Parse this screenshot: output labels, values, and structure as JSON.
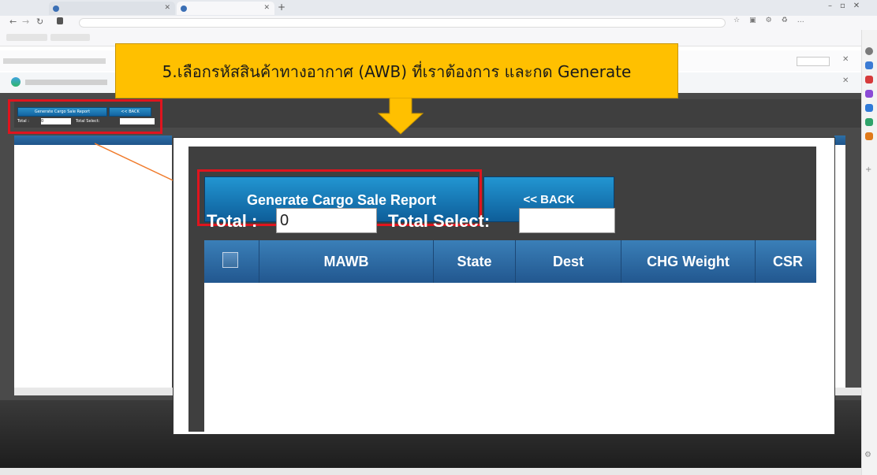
{
  "annotation": {
    "callout_text": "5.เลือกรหัสสินค้าทางอากาศ (AWB) ที่เราต้องการ และกด Generate"
  },
  "app": {
    "generate_button": "Generate Cargo Sale Report",
    "back_button": "<< BACK",
    "total_label": "Total :",
    "total_value": "0",
    "total_select_label": "Total Select:",
    "total_select_value": "",
    "columns": [
      "MAWB",
      "State",
      "Dest",
      "CHG Weight",
      "CSR"
    ]
  },
  "colors": {
    "callout_bg": "#ffc000",
    "highlight_border": "#e0141e",
    "button_blue": "#1a7dbb",
    "table_header": "#2d6aa3",
    "page_dark": "#3f3f3f"
  },
  "icons": [
    "back-arrow-icon",
    "forward-arrow-icon",
    "refresh-icon",
    "home-icon",
    "lock-icon",
    "star-icon",
    "settings-icon",
    "close-icon",
    "checkbox-icon",
    "arrow-down-icon"
  ]
}
